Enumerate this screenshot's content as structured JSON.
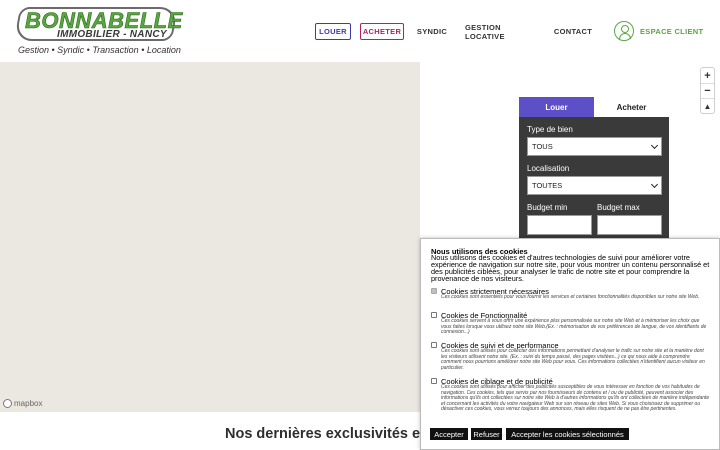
{
  "header": {
    "logo_title": "BONNABELLE",
    "logo_sub": "IMMOBILIER - NANCY",
    "tagline": "Gestion • Syndic • Transaction • Location",
    "nav": {
      "louer": "LOUER",
      "acheter": "ACHETER",
      "syndic": "SYNDIC",
      "gestion": "GESTION LOCATIVE",
      "contact": "CONTACT"
    },
    "espace_client": "ESPACE CLIENT",
    "colors": {
      "green": "#5aa642",
      "louer": "#3d3daa",
      "acheter": "#b0245e"
    }
  },
  "map": {
    "attribution": "mapbox",
    "zoom_in": "+",
    "zoom_out": "−",
    "compass": "▲"
  },
  "search": {
    "tab_louer": "Louer",
    "tab_acheter": "Acheter",
    "type_label": "Type de bien",
    "type_value": "TOUS",
    "loc_label": "Localisation",
    "loc_value": "TOUTES",
    "budget_min_label": "Budget min",
    "budget_max_label": "Budget max",
    "colors": {
      "panel": "#3a3a3a",
      "active_tab": "#5c4fc7"
    }
  },
  "main": {
    "heading": "Nos dernières exclusivités en"
  },
  "cookie": {
    "title": "Nous utilisons des cookies",
    "intro": "Nous utilisons des cookies et d'autres technologies de suivi pour améliorer votre expérience de navigation sur notre site, pour vous montrer un contenu personnalisé et des publicités ciblées, pour analyser le trafic de notre site et pour comprendre la provenance de nos visiteurs.",
    "items": [
      {
        "name": "Cookies strictement nécessaires",
        "desc": "Ces cookies sont essentiels pour vous fournir les services et certaines fonctionnalités disponibles sur notre site Web."
      },
      {
        "name": "Cookies de Fonctionnalité",
        "desc": "Ces cookies servent à vous offrir une expérience plus personnalisée sur notre site Web et à mémoriser les choix que vous faites lorsque vous utilisez notre site Web.(Ex. : mémorisation de vos préférences de langue, de vos identifiants de connexion...)"
      },
      {
        "name": "Cookies de suivi et de performance",
        "desc": "Ces cookies sont utilisés pour collecter des informations permettant d'analyser le trafic sur notre site et la manière dont les visiteurs utilisent notre site. (Ex. : suivi du temps passé, des pages visitées...) ce qui nous aide à comprendre comment nous pourrions améliorer notre site Web pour vous. Ces informations collectées n'identifient aucun visiteur en particulier."
      },
      {
        "name": "Cookies de ciblage et de publicité",
        "desc": "Ces cookies sont utilisés pour afficher des publicités susceptibles de vous intéresser en fonction de vos habitudes de navigation. Ces cookies, tels que servis par nos fournisseurs de contenu et / ou de publicité, peuvent associer des informations qu'ils ont collectées sur notre site Web à d'autres informations qu'ils ont collectées de manière indépendante et concernant les activités du votre navigateur Web sur son réseau de sites Web. Si vous choisissez de supprimer ou désactiver ces cookies, vous verrez toujours des annonces, mais elles risquent de ne pas être pertinentes."
      }
    ],
    "accept": "Accepter",
    "refuse": "Refuser",
    "accept_selected": "Accepter les cookies sélectionnés"
  }
}
